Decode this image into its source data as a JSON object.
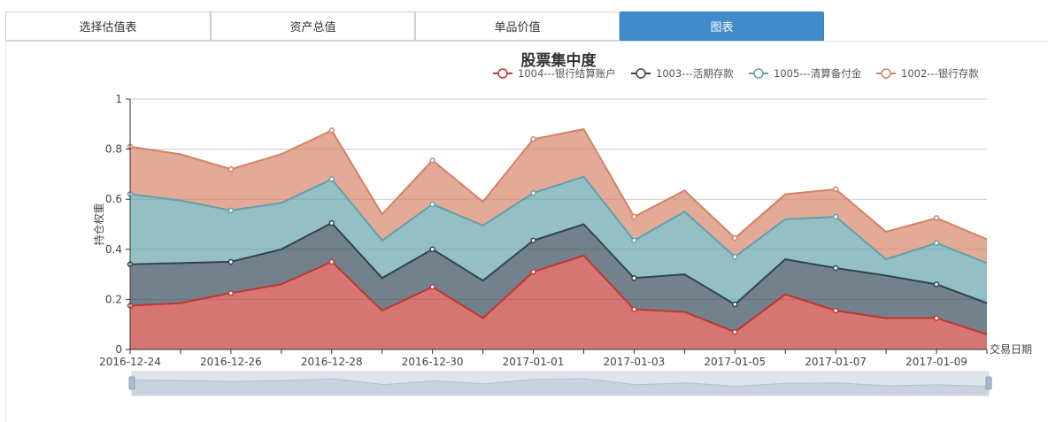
{
  "tabs": [
    {
      "label": "选择估值表",
      "active": false
    },
    {
      "label": "资产总值",
      "active": false
    },
    {
      "label": "单品价值",
      "active": false
    },
    {
      "label": "图表",
      "active": true
    }
  ],
  "chart_data": {
    "type": "area",
    "stacked": true,
    "title": "股票集中度",
    "xlabel": "交易日期",
    "ylabel": "持仓权重",
    "ylim": [
      0,
      1
    ],
    "yticks": [
      "0",
      "0.2",
      "0.4",
      "0.6",
      "0.8",
      "1"
    ],
    "x": [
      "2016-12-24",
      "2016-12-25",
      "2016-12-26",
      "2016-12-27",
      "2016-12-28",
      "2016-12-29",
      "2016-12-30",
      "2016-12-31",
      "2017-01-01",
      "2017-01-02",
      "2017-01-03",
      "2017-01-04",
      "2017-01-05",
      "2017-01-06",
      "2017-01-07",
      "2017-01-08",
      "2017-01-09",
      "2017-01-10"
    ],
    "xtick_labels": [
      "2016-12-24",
      "2016-12-26",
      "2016-12-28",
      "2016-12-30",
      "2017-01-01",
      "2017-01-03",
      "2017-01-05",
      "2017-01-07",
      "2017-01-09"
    ],
    "legend_position": "top-right",
    "grid": true,
    "series": [
      {
        "name": "1004---银行结算账户",
        "color": "#c23531",
        "values": [
          0.175,
          0.185,
          0.225,
          0.26,
          0.35,
          0.155,
          0.25,
          0.125,
          0.31,
          0.375,
          0.16,
          0.15,
          0.07,
          0.22,
          0.155,
          0.125,
          0.125,
          0.06
        ]
      },
      {
        "name": "1003---活期存款",
        "color": "#2f4554",
        "values": [
          0.165,
          0.16,
          0.125,
          0.14,
          0.155,
          0.13,
          0.15,
          0.15,
          0.125,
          0.125,
          0.125,
          0.15,
          0.11,
          0.14,
          0.17,
          0.17,
          0.135,
          0.125
        ]
      },
      {
        "name": "1005---清算备付金",
        "color": "#61a0a8",
        "values": [
          0.28,
          0.25,
          0.205,
          0.185,
          0.175,
          0.15,
          0.18,
          0.22,
          0.19,
          0.19,
          0.15,
          0.25,
          0.19,
          0.16,
          0.205,
          0.065,
          0.165,
          0.16
        ]
      },
      {
        "name": "1002---银行存款",
        "color": "#d48265",
        "values": [
          0.19,
          0.185,
          0.165,
          0.195,
          0.195,
          0.105,
          0.175,
          0.095,
          0.215,
          0.19,
          0.095,
          0.085,
          0.075,
          0.1,
          0.11,
          0.11,
          0.1,
          0.095
        ]
      }
    ]
  }
}
